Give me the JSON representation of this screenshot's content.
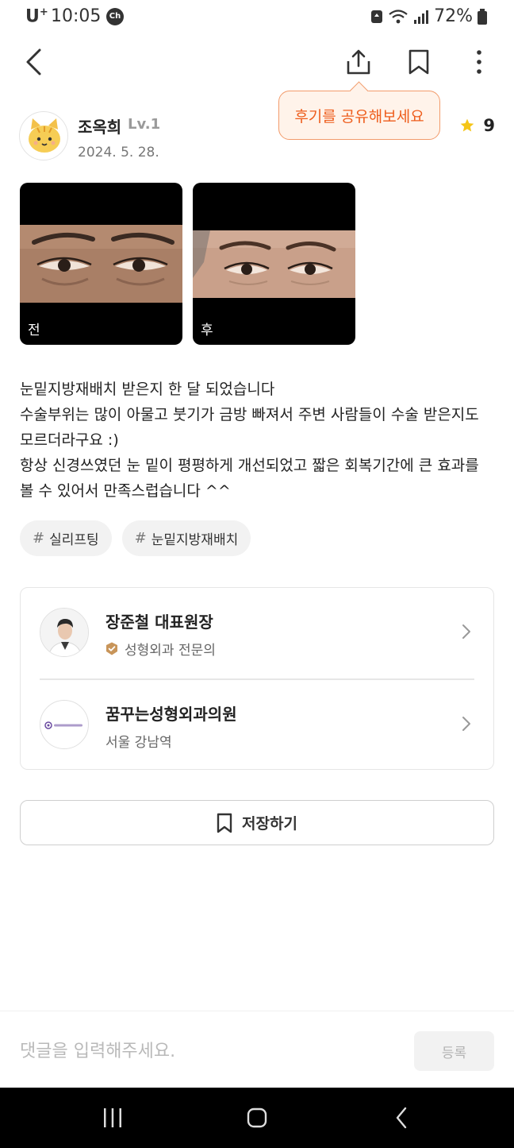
{
  "status_bar": {
    "carrier": "U",
    "carrier_sup": "+",
    "time": "10:05",
    "chat_badge": "Ch",
    "battery": "72%"
  },
  "top_bar": {
    "icons": [
      "back-arrow-icon",
      "share-icon",
      "bookmark-icon",
      "more-vertical-icon"
    ]
  },
  "tooltip": {
    "text": "후기를 공유해보세요"
  },
  "author": {
    "name": "조옥희",
    "level": "Lv.1",
    "date": "2024. 5. 28.",
    "rating": "9"
  },
  "photos": [
    {
      "label": "전"
    },
    {
      "label": "후"
    }
  ],
  "review": {
    "text": "눈밑지방재배치 받은지 한 달 되었습니다\n수술부위는 많이 아물고 붓기가 금방 빠져서 주변 사람들이 수술 받은지도 모르더라구요 :)\n항상 신경쓰였던 눈 밑이 평평하게 개선되었고 짧은 회복기간에 큰 효과를 볼 수 있어서 만족스럽습니다 ^^"
  },
  "tags": [
    {
      "hash": "#",
      "label": "실리프팅"
    },
    {
      "hash": "#",
      "label": "눈밑지방재배치"
    }
  ],
  "doctor": {
    "name": "장준철 대표원장",
    "specialty": "성형외과 전문의"
  },
  "clinic": {
    "name": "꿈꾸는성형외과의원",
    "location": "서울 강남역",
    "logo_text": "꿈꾸는성형외과"
  },
  "save_button": {
    "label": "저장하기"
  },
  "comment": {
    "placeholder": "댓글을 입력해주세요.",
    "submit_label": "등록"
  },
  "colors": {
    "accent": "#ee5d1c",
    "tooltip_bg": "#fff3ea",
    "star": "#f5c518",
    "verified_badge": "#c8955a"
  }
}
